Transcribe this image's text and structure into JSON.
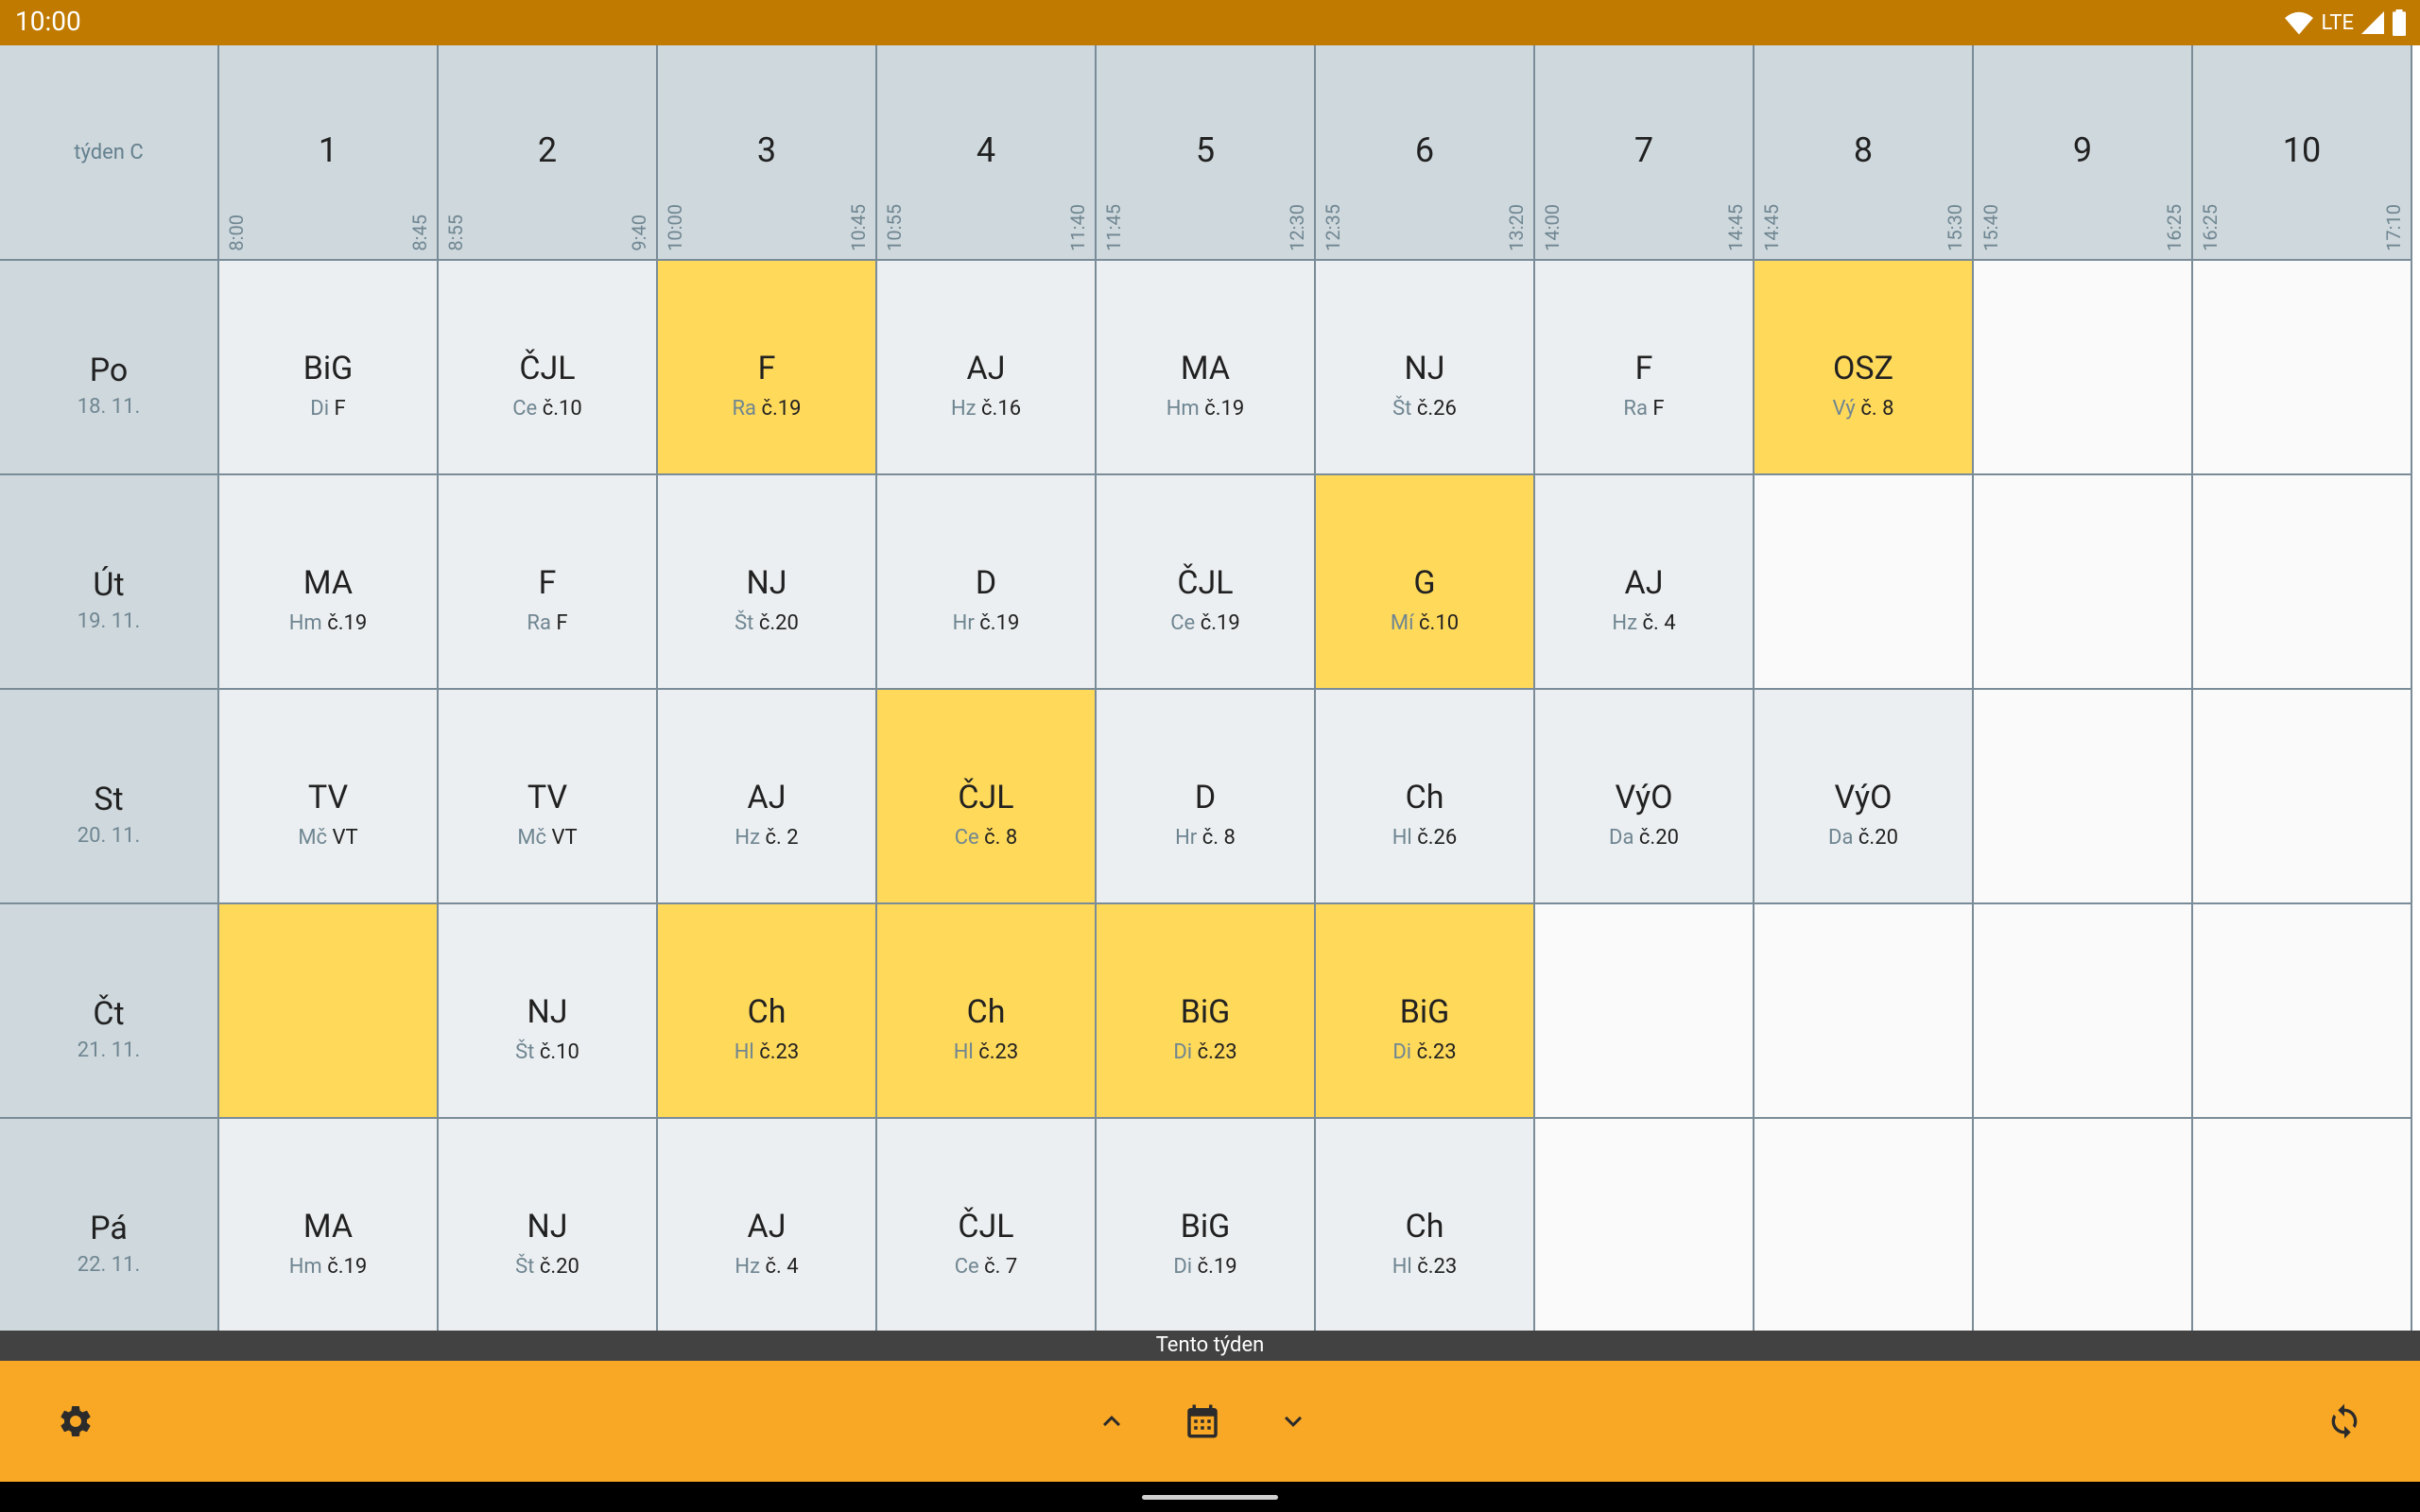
{
  "status_bar": {
    "time": "10:00",
    "network": "LTE"
  },
  "week_label": "týden C",
  "periods": [
    {
      "num": "1",
      "start": "8:00",
      "end": "8:45"
    },
    {
      "num": "2",
      "start": "8:55",
      "end": "9:40"
    },
    {
      "num": "3",
      "start": "10:00",
      "end": "10:45"
    },
    {
      "num": "4",
      "start": "10:55",
      "end": "11:40"
    },
    {
      "num": "5",
      "start": "11:45",
      "end": "12:30"
    },
    {
      "num": "6",
      "start": "12:35",
      "end": "13:20"
    },
    {
      "num": "7",
      "start": "14:00",
      "end": "14:45"
    },
    {
      "num": "8",
      "start": "14:45",
      "end": "15:30"
    },
    {
      "num": "9",
      "start": "15:40",
      "end": "16:25"
    },
    {
      "num": "10",
      "start": "16:25",
      "end": "17:10"
    }
  ],
  "days": [
    {
      "name": "Po",
      "date": "18. 11.",
      "lessons": [
        {
          "subject": "BiG",
          "teacher": "Di",
          "room": "F",
          "highlight": false
        },
        {
          "subject": "ČJL",
          "teacher": "Ce",
          "room": "č.10",
          "highlight": false
        },
        {
          "subject": "F",
          "teacher": "Ra",
          "room": "č.19",
          "highlight": true
        },
        {
          "subject": "AJ",
          "teacher": "Hz",
          "room": "č.16",
          "highlight": false
        },
        {
          "subject": "MA",
          "teacher": "Hm",
          "room": "č.19",
          "highlight": false
        },
        {
          "subject": "NJ",
          "teacher": "Št",
          "room": "č.26",
          "highlight": false
        },
        {
          "subject": "F",
          "teacher": "Ra",
          "room": "F",
          "highlight": false
        },
        {
          "subject": "OSZ",
          "teacher": "Vý",
          "room": "č. 8",
          "highlight": true
        },
        null,
        null
      ]
    },
    {
      "name": "Út",
      "date": "19. 11.",
      "lessons": [
        {
          "subject": "MA",
          "teacher": "Hm",
          "room": "č.19",
          "highlight": false
        },
        {
          "subject": "F",
          "teacher": "Ra",
          "room": "F",
          "highlight": false
        },
        {
          "subject": "NJ",
          "teacher": "Št",
          "room": "č.20",
          "highlight": false
        },
        {
          "subject": "D",
          "teacher": "Hr",
          "room": "č.19",
          "highlight": false
        },
        {
          "subject": "ČJL",
          "teacher": "Ce",
          "room": "č.19",
          "highlight": false
        },
        {
          "subject": "G",
          "teacher": "Mí",
          "room": "č.10",
          "highlight": true
        },
        {
          "subject": "AJ",
          "teacher": "Hz",
          "room": "č. 4",
          "highlight": false
        },
        null,
        null,
        null
      ]
    },
    {
      "name": "St",
      "date": "20. 11.",
      "lessons": [
        {
          "subject": "TV",
          "teacher": "Mč",
          "room": "VT",
          "highlight": false
        },
        {
          "subject": "TV",
          "teacher": "Mč",
          "room": "VT",
          "highlight": false
        },
        {
          "subject": "AJ",
          "teacher": "Hz",
          "room": "č. 2",
          "highlight": false
        },
        {
          "subject": "ČJL",
          "teacher": "Ce",
          "room": "č. 8",
          "highlight": true
        },
        {
          "subject": "D",
          "teacher": "Hr",
          "room": "č. 8",
          "highlight": false
        },
        {
          "subject": "Ch",
          "teacher": "Hl",
          "room": "č.26",
          "highlight": false
        },
        {
          "subject": "VýO",
          "teacher": "Da",
          "room": "č.20",
          "highlight": false
        },
        {
          "subject": "VýO",
          "teacher": "Da",
          "room": "č.20",
          "highlight": false
        },
        null,
        null
      ]
    },
    {
      "name": "Čt",
      "date": "21. 11.",
      "lessons": [
        {
          "subject": "",
          "teacher": "",
          "room": "",
          "highlight": true
        },
        {
          "subject": "NJ",
          "teacher": "Št",
          "room": "č.10",
          "highlight": false
        },
        {
          "subject": "Ch",
          "teacher": "Hl",
          "room": "č.23",
          "highlight": true
        },
        {
          "subject": "Ch",
          "teacher": "Hl",
          "room": "č.23",
          "highlight": true
        },
        {
          "subject": "BiG",
          "teacher": "Di",
          "room": "č.23",
          "highlight": true
        },
        {
          "subject": "BiG",
          "teacher": "Di",
          "room": "č.23",
          "highlight": true
        },
        null,
        null,
        null,
        null
      ]
    },
    {
      "name": "Pá",
      "date": "22. 11.",
      "lessons": [
        {
          "subject": "MA",
          "teacher": "Hm",
          "room": "č.19",
          "highlight": false
        },
        {
          "subject": "NJ",
          "teacher": "Št",
          "room": "č.20",
          "highlight": false
        },
        {
          "subject": "AJ",
          "teacher": "Hz",
          "room": "č. 4",
          "highlight": false
        },
        {
          "subject": "ČJL",
          "teacher": "Ce",
          "room": "č. 7",
          "highlight": false
        },
        {
          "subject": "BiG",
          "teacher": "Di",
          "room": "č.19",
          "highlight": false
        },
        {
          "subject": "Ch",
          "teacher": "Hl",
          "room": "č.23",
          "highlight": false
        },
        null,
        null,
        null,
        null
      ]
    }
  ],
  "bottom_label": "Tento týden",
  "toolbar": {
    "settings_icon": "gear-icon",
    "prev_icon": "chevron-up-icon",
    "calendar_icon": "calendar-icon",
    "next_icon": "chevron-down-icon",
    "refresh_icon": "sync-icon"
  },
  "colors": {
    "status_bar": "#c17a00",
    "toolbar": "#f9a825",
    "highlight": "#ffd95a",
    "header": "#cfd8dc",
    "lesson": "#eceff1"
  }
}
